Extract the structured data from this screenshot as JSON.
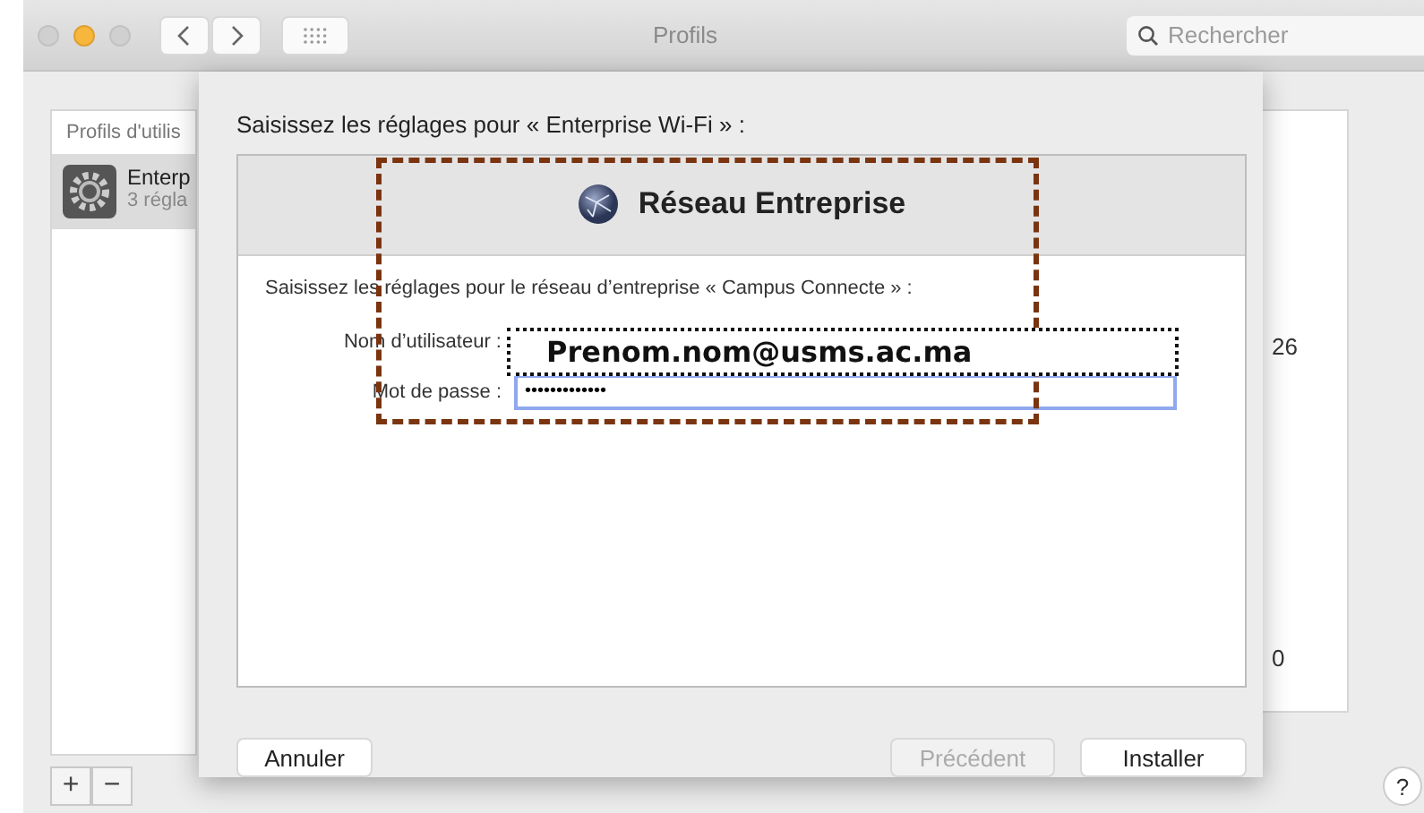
{
  "window": {
    "title": "Profils",
    "search": {
      "placeholder": "Rechercher"
    },
    "traffic_lights": [
      {
        "on": false
      },
      {
        "on": true
      },
      {
        "on": false
      }
    ]
  },
  "sidebar": {
    "header": "Profils d'utilis",
    "items": [
      {
        "name": "Enterp",
        "detail": "3 régla",
        "selected": true
      }
    ],
    "buttons": [
      "+",
      "−"
    ]
  },
  "detail_panel": {
    "values": [
      "26",
      "0"
    ]
  },
  "sheet": {
    "title": "Saisissez les réglages pour « Enterprise Wi-Fi » :",
    "header": "Réseau Entreprise",
    "prompt": "Saisissez les réglages pour le réseau d’entreprise « Campus Connecte » :",
    "fields": [
      {
        "label": "Nom d’utilisateur :",
        "kind": "covered"
      },
      {
        "label": "Mot de passe :",
        "kind": "input",
        "value": "•••••••••••••",
        "focused": true
      }
    ],
    "buttons": [
      {
        "label": "Annuler",
        "disabled": false
      },
      {
        "label": "Précédent",
        "disabled": true
      },
      {
        "label": "Installer",
        "disabled": false
      }
    ]
  },
  "annotation": {
    "text": "Prenom.nom@usms.ac.ma"
  },
  "help": "?"
}
